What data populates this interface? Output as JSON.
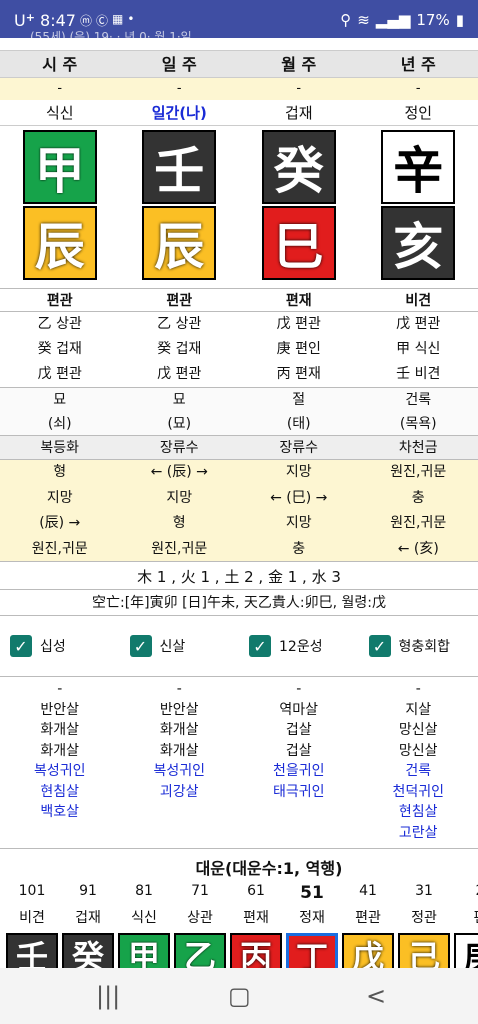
{
  "status": {
    "carrier": "U",
    "carrier_plus": "+",
    "time": "8:47",
    "icons": [
      "ⓜ",
      "Ⓒ",
      "▦",
      "•"
    ],
    "battery": "17%",
    "subtitle": "(55세) (음) 19· · 년 0· 월 1·일"
  },
  "columns": {
    "headers": [
      "시 주",
      "일 주",
      "월 주",
      "년 주"
    ],
    "dashes": [
      "-",
      "-",
      "-",
      "-"
    ],
    "roles": [
      "식신",
      "일간(나)",
      "겁재",
      "정인"
    ]
  },
  "heavenly": [
    {
      "char": "甲",
      "color": "green"
    },
    {
      "char": "壬",
      "color": "dark"
    },
    {
      "char": "癸",
      "color": "dark"
    },
    {
      "char": "辛",
      "color": "white"
    }
  ],
  "earthly": [
    {
      "char": "辰",
      "color": "yellow"
    },
    {
      "char": "辰",
      "color": "yellow"
    },
    {
      "char": "巳",
      "color": "red"
    },
    {
      "char": "亥",
      "color": "dark"
    }
  ],
  "ten_gods": [
    "편관",
    "편관",
    "편재",
    "비견"
  ],
  "hidden_stems": [
    [
      "乙 상관",
      "癸 겁재",
      "戊 편관"
    ],
    [
      "乙 상관",
      "癸 겁재",
      "戊 편관"
    ],
    [
      "戊 편관",
      "庚 편인",
      "丙 편재"
    ],
    [
      "戊 편관",
      "甲 식신",
      "壬 비견"
    ]
  ],
  "unsung": [
    [
      "묘",
      "(쇠)"
    ],
    [
      "묘",
      "(묘)"
    ],
    [
      "절",
      "(태)"
    ],
    [
      "건록",
      "(목욕)"
    ]
  ],
  "sinsal": [
    "복등화",
    "장류수",
    "장류수",
    "차천금"
  ],
  "relations": [
    [
      "형",
      "지망",
      "(辰) →",
      "원진,귀문"
    ],
    [
      "← (辰) →",
      "지망",
      "형",
      "원진,귀문"
    ],
    [
      "지망",
      "← (巳) →",
      "지망",
      "충"
    ],
    [
      "원진,귀문",
      "충",
      "원진,귀문",
      "← (亥)"
    ]
  ],
  "summary": "木 1 , 火 1 , 土 2 , 金 1 , 水 3",
  "gongmang": "空亡:[年]寅卯 [日]午未, 天乙貴人:卯巳, 월령:戊",
  "checkboxes": [
    "십성",
    "신살",
    "12운성",
    "형충회합"
  ],
  "sal_columns": [
    {
      "plain": [
        "-",
        "반안살",
        "화개살",
        "화개살"
      ],
      "blue": [
        "복성귀인",
        "현침살",
        "백호살"
      ]
    },
    {
      "plain": [
        "-",
        "반안살",
        "화개살",
        "화개살"
      ],
      "blue": [
        "복성귀인",
        "괴강살"
      ]
    },
    {
      "plain": [
        "-",
        "역마살",
        "겁살",
        "겁살"
      ],
      "blue": [
        "천을귀인",
        "태극귀인"
      ]
    },
    {
      "plain": [
        "-",
        "지살",
        "망신살",
        "망신살"
      ],
      "blue": [
        "건록",
        "천덕귀인",
        "현침살",
        "고란살"
      ]
    }
  ],
  "daewoon": {
    "title": "대운(대운수:1, 역행)",
    "ages": [
      "101",
      "91",
      "81",
      "71",
      "61",
      "51",
      "41",
      "31",
      "2"
    ],
    "roles": [
      "비견",
      "겁재",
      "식신",
      "상관",
      "편재",
      "정재",
      "편관",
      "정관",
      "편"
    ],
    "tiles": [
      {
        "char": "壬",
        "color": "dark"
      },
      {
        "char": "癸",
        "color": "dark"
      },
      {
        "char": "甲",
        "color": "green"
      },
      {
        "char": "乙",
        "color": "green"
      },
      {
        "char": "丙",
        "color": "red"
      },
      {
        "char": "丁",
        "color": "red"
      },
      {
        "char": "戊",
        "color": "yellow"
      },
      {
        "char": "己",
        "color": "yellow"
      },
      {
        "char": "庚",
        "color": "white"
      }
    ],
    "current_index": 5
  },
  "nav": {
    "recent": "|||",
    "home": "▢",
    "back": "<"
  }
}
